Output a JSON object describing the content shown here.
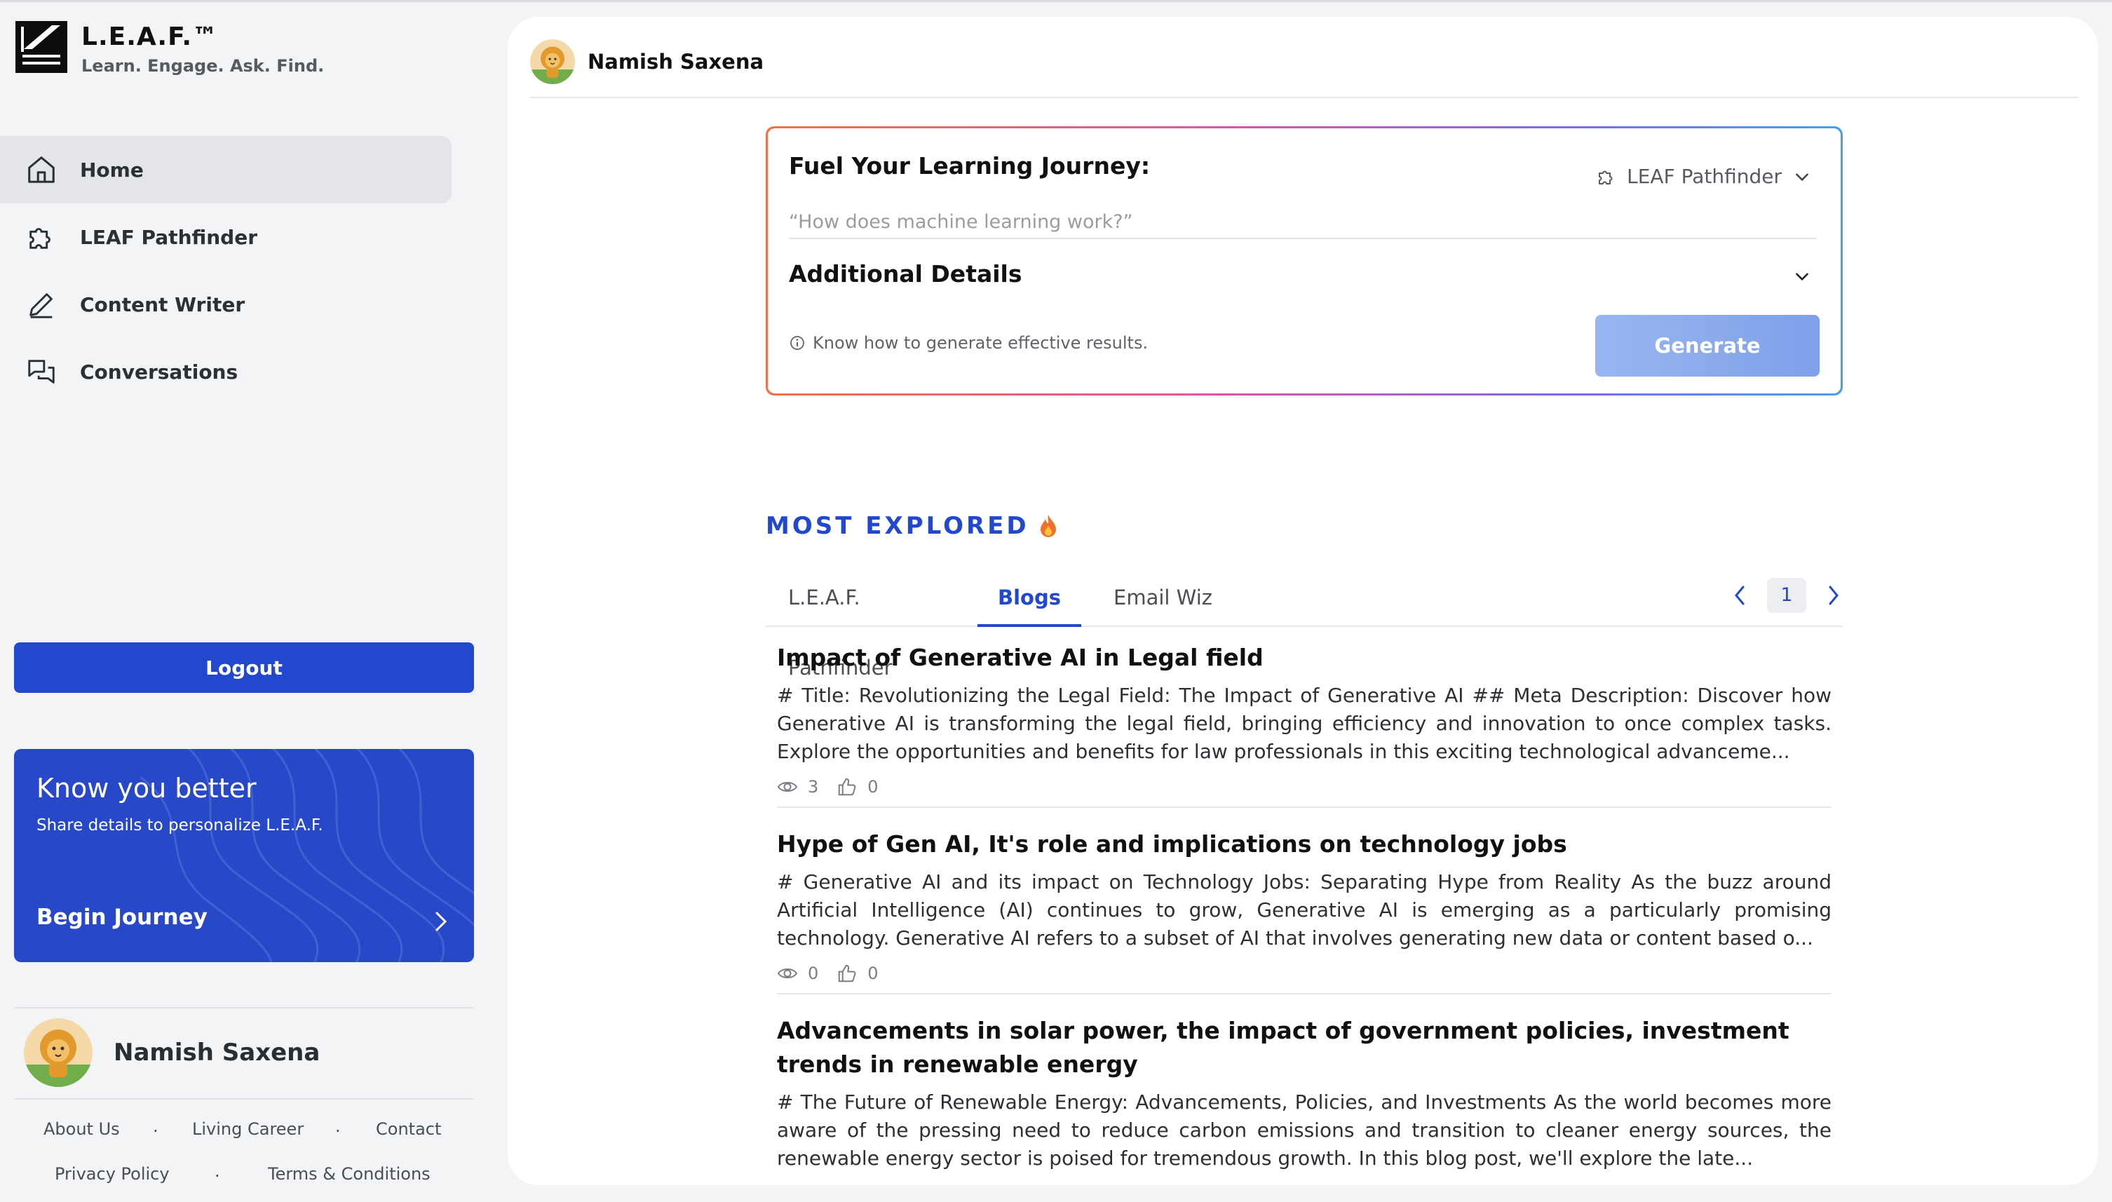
{
  "brand": {
    "title": "L.E.A.F.™",
    "tagline": "Learn. Engage. Ask. Find."
  },
  "sidebar": {
    "items": [
      {
        "label": "Home",
        "icon": "home-icon",
        "active": true
      },
      {
        "label": "LEAF Pathfinder",
        "icon": "puzzle-icon",
        "active": false
      },
      {
        "label": "Content Writer",
        "icon": "pencil-icon",
        "active": false
      },
      {
        "label": "Conversations",
        "icon": "chat-bubbles-icon",
        "active": false
      }
    ],
    "logout_label": "Logout",
    "know_card": {
      "title": "Know you better",
      "subtitle": "Share details to personalize L.E.A.F.",
      "cta": "Begin Journey"
    },
    "user_name": "Namish Saxena",
    "footer": {
      "about": "About Us",
      "sep1": ".",
      "living_career": "Living Career",
      "sep2": ".",
      "contact": "Contact",
      "privacy": "Privacy Policy",
      "sep3": ".",
      "terms": "Terms & Conditions"
    }
  },
  "header": {
    "user_name": "Namish Saxena"
  },
  "journey": {
    "title": "Fuel Your Learning Journey:",
    "mode_label": "LEAF Pathfinder",
    "input_placeholder": "“How does machine learning work?”",
    "additional_details": "Additional Details",
    "hint": "Know how to generate effective results.",
    "generate_label": "Generate"
  },
  "most_explored": {
    "title": "MOST EXPLORED",
    "tabs": [
      {
        "label": "L.E.A.F. Pathfinder",
        "active": false
      },
      {
        "label": "Blogs",
        "active": true
      },
      {
        "label": "Email Wiz",
        "active": false
      }
    ],
    "page": "1"
  },
  "blogs": [
    {
      "title": "Impact of Generative AI in Legal field",
      "body": "# Title: Revolutionizing the Legal Field: The Impact of Generative AI ## Meta Description: Discover how Generative AI is transforming the legal field, bringing efficiency and innovation to once complex tasks. Explore the opportunities and benefits for law professionals in this exciting technological advanceme...",
      "views": "3",
      "likes": "0"
    },
    {
      "title": "Hype of Gen AI, It's role and implications on technology jobs",
      "body": "# Generative AI and its impact on Technology Jobs: Separating Hype from Reality As the buzz around Artificial Intelligence (AI) continues to grow, Generative AI is emerging as a particularly promising technology. Generative AI refers to a subset of AI that involves generating new data or content based o...",
      "views": "0",
      "likes": "0"
    },
    {
      "title": "Advancements in solar power, the impact of government policies, investment trends in renewable energy",
      "body": "# The Future of Renewable Energy: Advancements, Policies, and Investments As the world becomes more aware of the pressing need to reduce carbon emissions and transition to cleaner energy sources, the renewable energy sector is poised for tremendous growth. In this blog post, we'll explore the late...",
      "views": "",
      "likes": ""
    }
  ],
  "colors": {
    "accent": "#2148cd",
    "card": "#2748c9",
    "generate": "#8aaaf0"
  }
}
